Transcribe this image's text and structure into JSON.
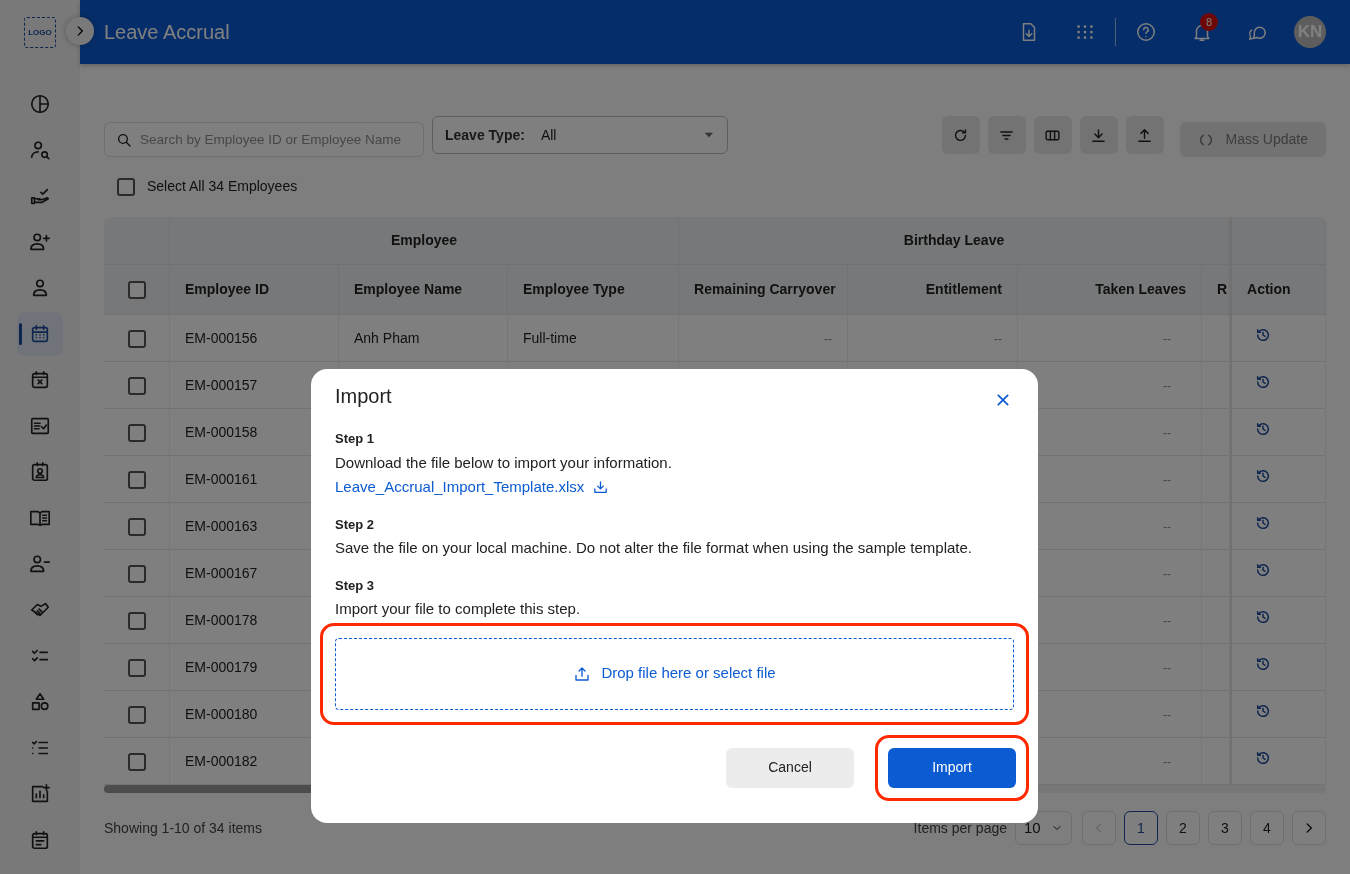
{
  "sidebar": {
    "logo": "LOGO",
    "items": [
      {
        "selected": false
      },
      {
        "selected": false
      },
      {
        "selected": false
      },
      {
        "selected": false
      },
      {
        "selected": false
      },
      {
        "selected": true
      },
      {
        "selected": false
      },
      {
        "selected": false
      },
      {
        "selected": false
      },
      {
        "selected": false
      },
      {
        "selected": false
      },
      {
        "selected": false
      },
      {
        "selected": false
      },
      {
        "selected": false
      },
      {
        "selected": false
      },
      {
        "selected": false
      },
      {
        "selected": false
      }
    ]
  },
  "header": {
    "title": "Leave Accrual",
    "notification_count": "8",
    "avatar_initials": "KN"
  },
  "toolbar": {
    "search": {
      "placeholder": "Search by Employee ID or Employee Name"
    },
    "leave_type": {
      "label": "Leave Type:",
      "value": "All"
    },
    "mass_update": {
      "label": "Mass Update",
      "disabled": true
    }
  },
  "select_all": {
    "label": "Select All 34 Employees",
    "checked": false
  },
  "table": {
    "column_groups": [
      {
        "label": "Employee",
        "columns": [
          "Employee ID",
          "Employee Name",
          "Employee Type"
        ]
      },
      {
        "label": "Birthday Leave",
        "columns": [
          "Remaining Carryover",
          "Entitlement",
          "Taken Leaves",
          "R"
        ]
      }
    ],
    "action_column": "Action",
    "header_checked": false,
    "rows": [
      {
        "checked": false,
        "employee_id": "EM-000156",
        "employee_name": "Anh Pham",
        "employee_type": "Full-time",
        "remaining_carryover": "--",
        "entitlement": "--",
        "taken_leaves": "--"
      },
      {
        "checked": false,
        "employee_id": "EM-000157",
        "taken_leaves": "--"
      },
      {
        "checked": false,
        "employee_id": "EM-000158",
        "taken_leaves": "--"
      },
      {
        "checked": false,
        "employee_id": "EM-000161",
        "taken_leaves": "--"
      },
      {
        "checked": false,
        "employee_id": "EM-000163",
        "taken_leaves": "--"
      },
      {
        "checked": false,
        "employee_id": "EM-000167",
        "taken_leaves": "--"
      },
      {
        "checked": false,
        "employee_id": "EM-000178",
        "taken_leaves": "--"
      },
      {
        "checked": false,
        "employee_id": "EM-000179",
        "taken_leaves": "--"
      },
      {
        "checked": false,
        "employee_id": "EM-000180",
        "taken_leaves": "--"
      },
      {
        "checked": false,
        "employee_id": "EM-000182",
        "taken_leaves": "--"
      }
    ]
  },
  "pagination": {
    "summary": "Showing 1-10 of 34 items",
    "per_page_label": "Items per page",
    "per_page": "10",
    "prev_disabled": true,
    "pages": [
      {
        "label": "1",
        "selected": true
      },
      {
        "label": "2",
        "selected": false
      },
      {
        "label": "3",
        "selected": false
      },
      {
        "label": "4",
        "selected": false
      }
    ]
  },
  "modal": {
    "title": "Import",
    "steps": [
      {
        "label": "Step 1",
        "text": "Download the file below to import your information.",
        "link": "Leave_Accrual_Import_Template.xlsx"
      },
      {
        "label": "Step 2",
        "text": "Save the file on your local machine. Do not alter the file format when using the sample template."
      },
      {
        "label": "Step 3",
        "text": "Import your file to complete this step."
      }
    ],
    "dropzone": {
      "label": "Drop file here or select file",
      "highlighted": true
    },
    "buttons": [
      {
        "label": "Cancel",
        "kind": "secondary",
        "highlighted": false
      },
      {
        "label": "Import",
        "kind": "primary",
        "highlighted": true
      }
    ]
  }
}
